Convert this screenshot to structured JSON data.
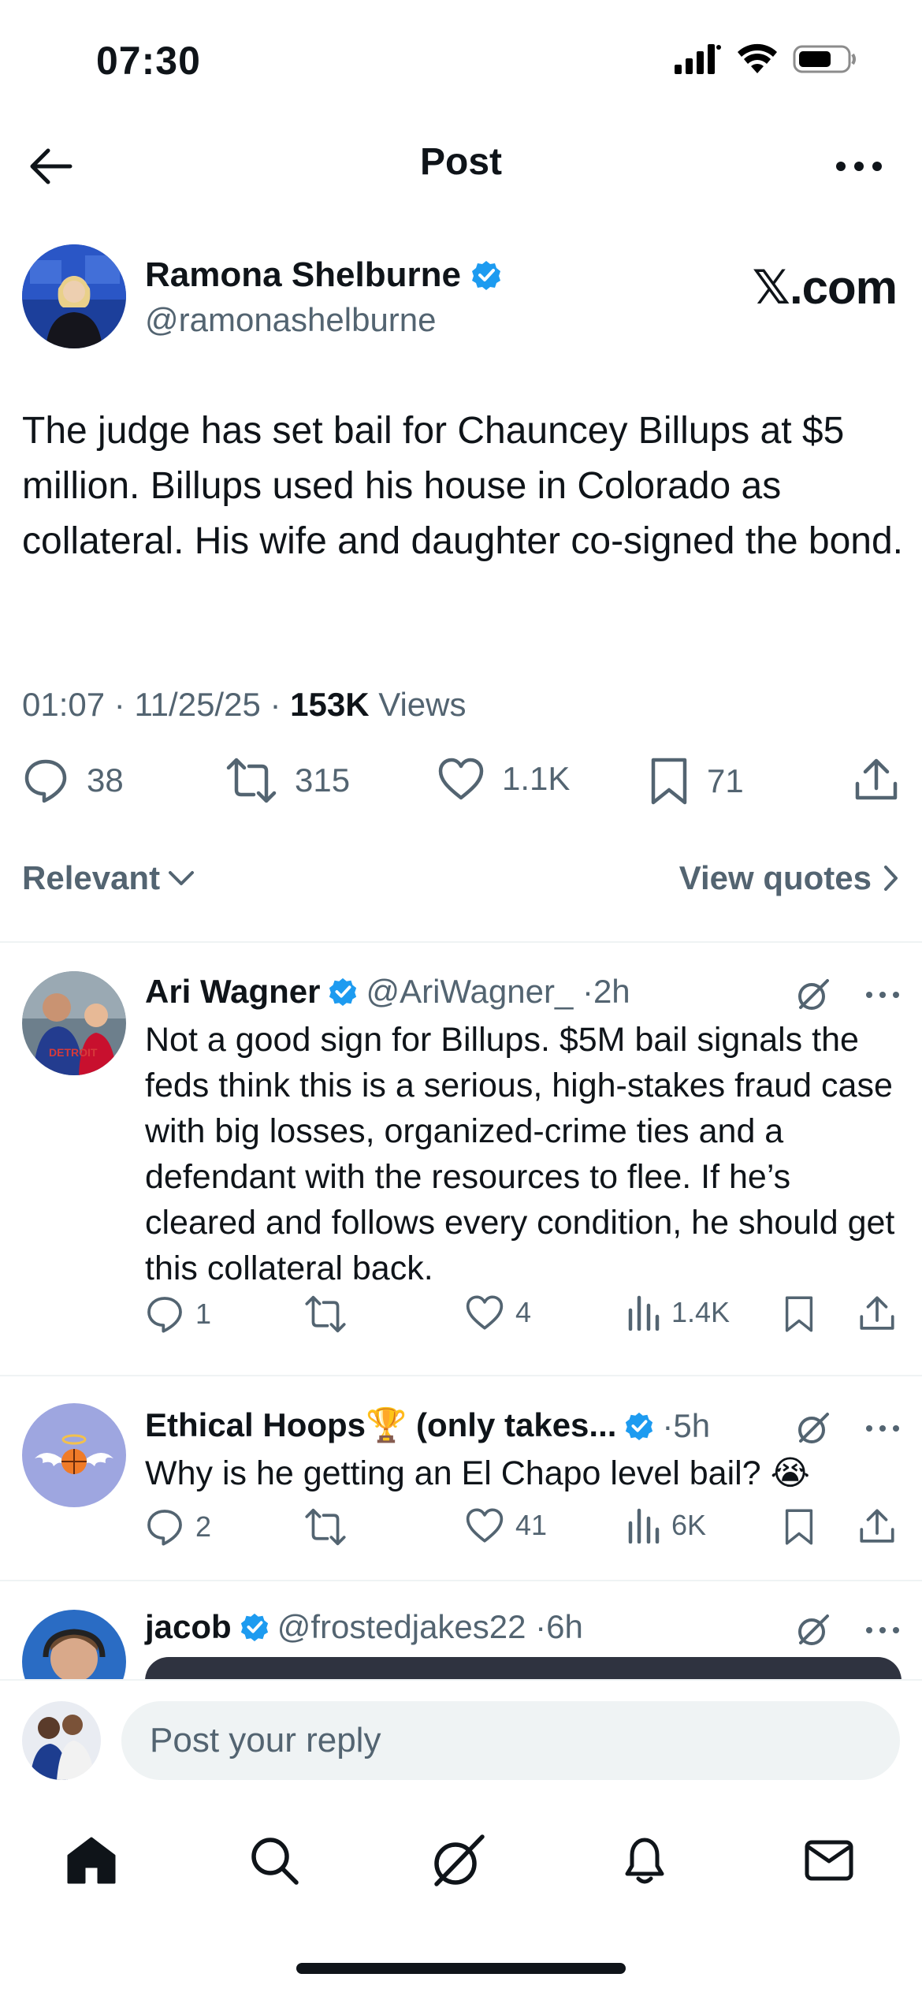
{
  "status_bar": {
    "time": "07:30"
  },
  "header": {
    "title": "Post"
  },
  "post": {
    "author_name": "Ramona Shelburne",
    "author_handle": "@ramonashelburne",
    "watermark": "𝕏.com",
    "text": "The judge has set bail for Chauncey Billups at $5 million. Billups used his house in Colorado as collateral. His wife and daughter co-signed the bond.",
    "time": "01:07",
    "date": "11/25/25",
    "views_count": "153K",
    "views_label": "Views",
    "replies": "38",
    "reposts": "315",
    "likes": "1.1K",
    "bookmarks": "71"
  },
  "sort": {
    "label": "Relevant",
    "quotes_label": "View quotes"
  },
  "replies": [
    {
      "name": "Ari Wagner",
      "handle": "@AriWagner_",
      "time": "2h",
      "text": "Not a good sign for Billups. $5M bail signals the feds think this is a serious, high-stakes fraud case with big losses, organized-crime ties and a defendant with the resources to flee. If he’s cleared and follows every condition, he should get this collateral back.",
      "replies": "1",
      "reposts": "",
      "likes": "4",
      "views": "1.4K"
    },
    {
      "name": "Ethical Hoops🏆 (only takes...",
      "handle": "",
      "time": "5h",
      "text": "Why is he getting an El Chapo level bail? 😭",
      "replies": "2",
      "reposts": "",
      "likes": "41",
      "views": "6K"
    },
    {
      "name": "jacob",
      "handle": "@frostedjakes22",
      "time": "6h"
    }
  ],
  "composer": {
    "placeholder": "Post your reply"
  },
  "colors": {
    "verified": "#1d9bf0",
    "secondary_text": "#536471",
    "primary_text": "#0f1419"
  }
}
